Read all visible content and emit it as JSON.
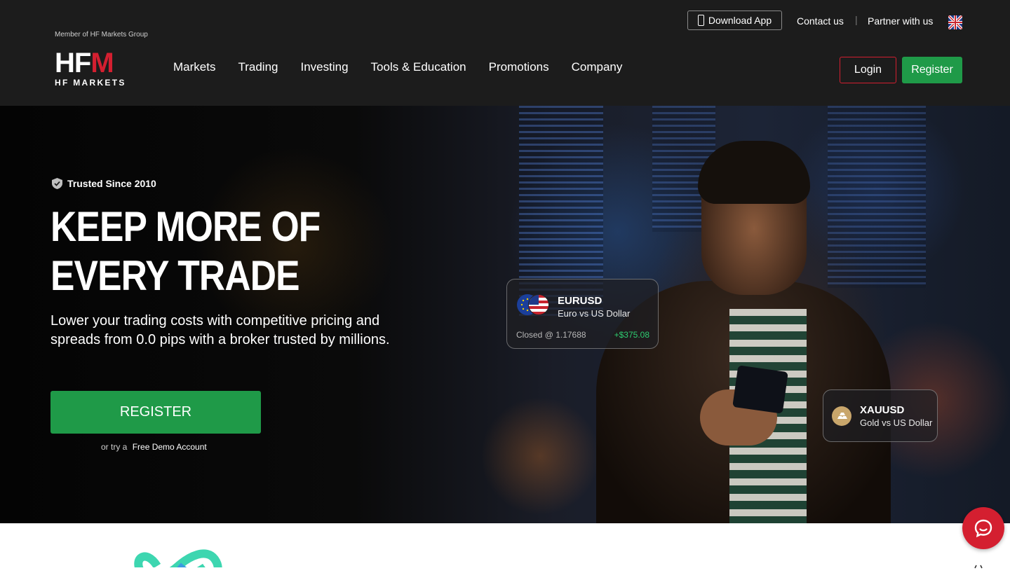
{
  "header": {
    "member_text": "Member of HF Markets Group",
    "logo_main_left": "HF",
    "logo_main_right": "M",
    "logo_sub": "HF MARKETS",
    "nav": [
      "Markets",
      "Trading",
      "Investing",
      "Tools & Education",
      "Promotions",
      "Company"
    ],
    "download_app": "Download App",
    "contact": "Contact us",
    "separator": "|",
    "partner": "Partner with us",
    "login": "Login",
    "register": "Register"
  },
  "hero": {
    "trusted": "Trusted Since 2010",
    "headline_line1": "KEEP MORE OF",
    "headline_line2": "EVERY TRADE",
    "subtitle": "Lower your trading costs with competitive pricing and spreads from 0.0 pips with a broker trusted by millions.",
    "cta": "REGISTER",
    "demo_prefix": "or try a",
    "demo_link": "Free Demo Account"
  },
  "cards": {
    "eurusd": {
      "pair": "EURUSD",
      "name": "Euro vs US Dollar",
      "closed": "Closed @ 1.17688",
      "profit": "+$375.08"
    },
    "xauusd": {
      "pair": "XAUUSD",
      "name": "Gold vs US Dollar"
    }
  },
  "colors": {
    "brand_red": "#d41f30",
    "brand_green": "#1f9a48",
    "header_bg": "#1c1c1c",
    "profit_green": "#2ecc71"
  },
  "icons": [
    "phone-icon",
    "uk-flag-icon",
    "shield-icon",
    "eu-flag-icon",
    "us-flag-icon",
    "gold-bars-icon",
    "chat-icon"
  ]
}
